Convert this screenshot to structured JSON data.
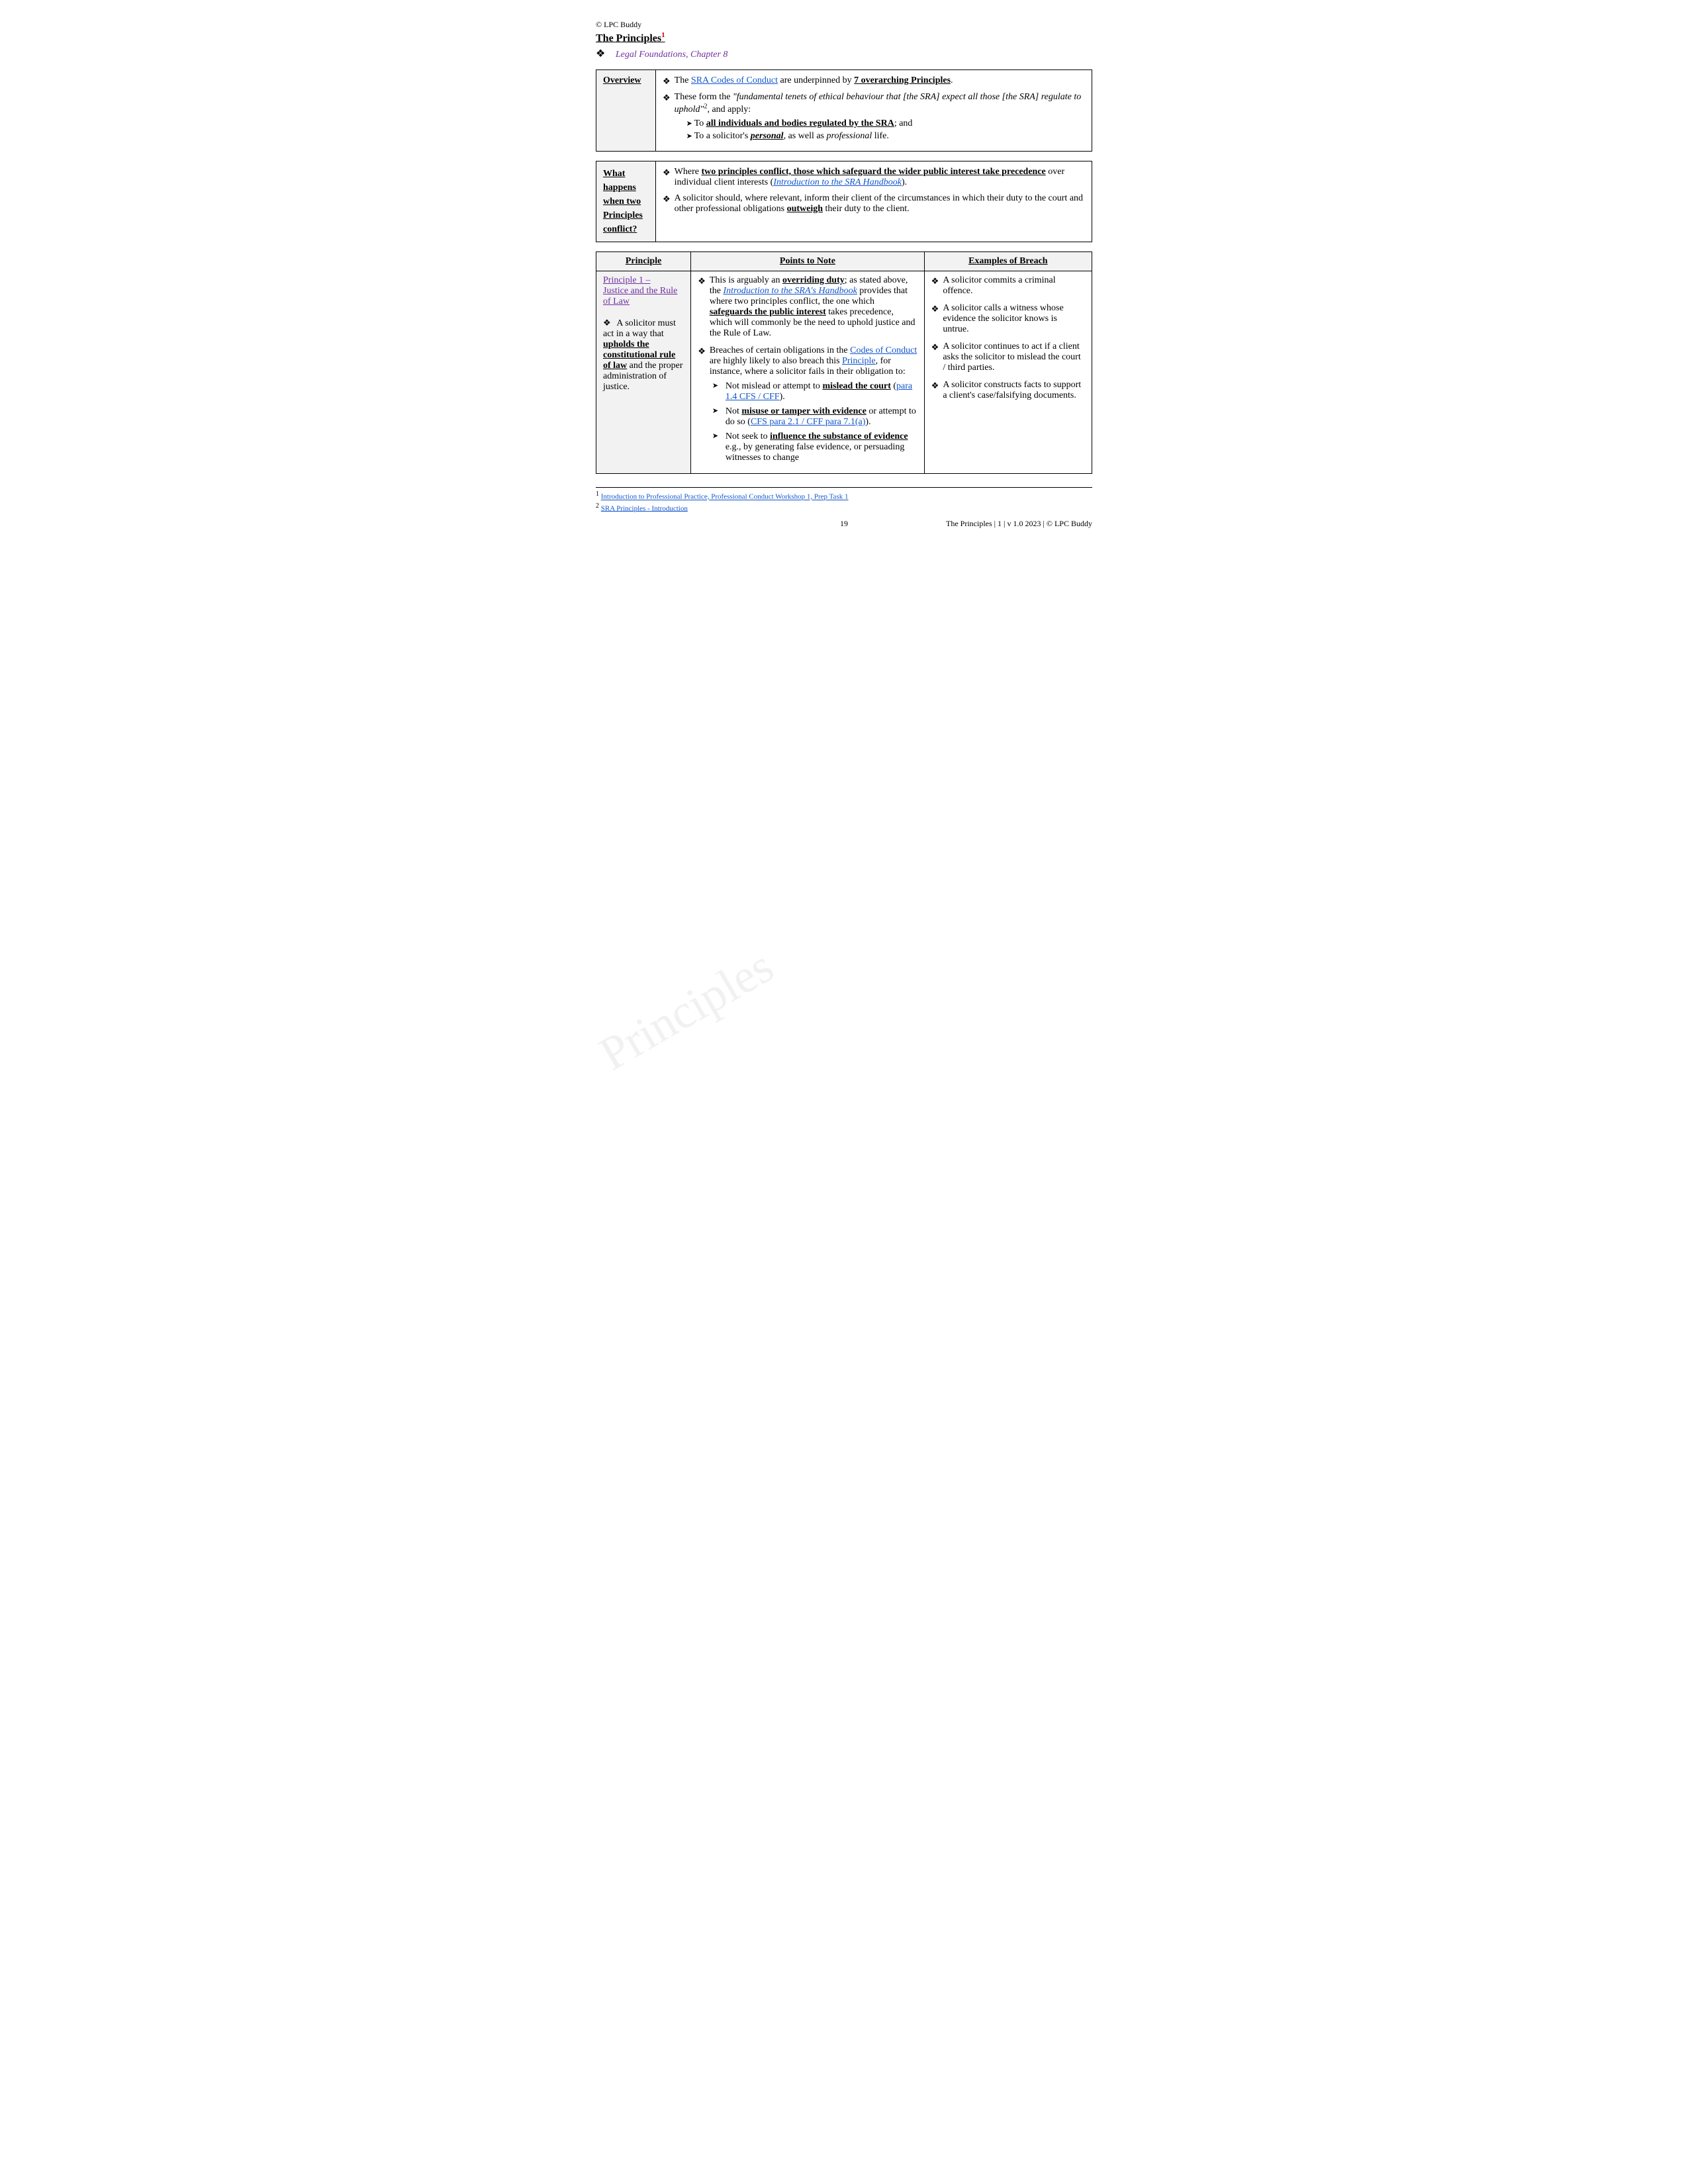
{
  "header": {
    "copyright": "© LPC Buddy",
    "title": "The Principles",
    "title_sup": "1",
    "chapter_link_text": "Legal Foundations, Chapter 8",
    "chapter_link_href": "#"
  },
  "overview": {
    "label": "Overview",
    "bullet1_pre": "The ",
    "bullet1_link": "SRA Codes of Conduct",
    "bullet1_post": " are underpinned by ",
    "bullet1_bold": "7 overarching Principles",
    "bullet1_dot": ".",
    "bullet2_pre": "These form the ",
    "bullet2_quote": "\"fundamental tenets of ethical behaviour that [the SRA] expect all those [the SRA] regulate to uphold\"",
    "bullet2_sup": "2",
    "bullet2_post": ", and apply:",
    "arrow1_bold": "all individuals and bodies regulated by the SRA",
    "arrow1_post": "; and",
    "arrow2_pre": "To a solicitor's ",
    "arrow2_italic_bold": "personal",
    "arrow2_mid": ", as well as ",
    "arrow2_italic": "professional",
    "arrow2_post": " life."
  },
  "what_happens": {
    "label_lines": [
      "What",
      "happens",
      "when two",
      "Principles",
      "conflict?"
    ],
    "bullet1_pre": "Where ",
    "bullet1_bold": "two principles conflict, those which safeguard the wider public interest take precedence",
    "bullet1_post": " over individual client interests (",
    "bullet1_link": "Introduction to the SRA Handbook",
    "bullet1_close": ").",
    "bullet2": "A solicitor should, where relevant, inform their client of the circumstances in which their duty to the court and other professional obligations ",
    "bullet2_bold": "outweigh",
    "bullet2_post": " their duty to the client."
  },
  "principles_table": {
    "headers": [
      "Principle",
      "Points to Note",
      "Examples of Breach"
    ],
    "row1": {
      "principle_link": "Principle 1 –",
      "principle_link2": "Justice and the Rule of Law",
      "principle_body": [
        "A solicitor must act in a way that ",
        "upholds the constitutional rule of law",
        " and the proper administration of justice."
      ],
      "points": [
        {
          "main_pre": "This is arguably an ",
          "main_bold_underline": "overriding duty",
          "main_post": "; as stated above, the ",
          "main_link": "Introduction to the SRA's Handbook",
          "main_link2": " provides that where two principles conflict, the one which ",
          "main_bold2": "safeguards the public interest",
          "main_post2": " takes precedence, which will commonly be the need to uphold justice and the Rule of Law."
        },
        {
          "main": "Breaches of certain obligations in the ",
          "main_link": "Codes of Conduct",
          "main_post": " are highly likely to also breach this ",
          "main_link2": "Principle",
          "main_post2": ", for instance, where a solicitor fails in their obligation to:",
          "arrows": [
            {
              "pre": "Not mislead or attempt to ",
              "bold_underline": "mislead the court",
              "post": " (",
              "link": "para 1.4 CFS / CFF",
              "close": ")."
            },
            {
              "pre": "Not ",
              "bold_underline": "misuse or tamper with evidence",
              "post": " or attempt to do so (",
              "link": "CFS para 2.1 / CFF para 7.1(a)",
              "close": ")."
            },
            {
              "pre": "Not seek to ",
              "bold_underline": "influence the substance of evidence",
              "post": " e.g., by generating false evidence, or persuading witnesses to change"
            }
          ]
        }
      ],
      "examples": [
        "A solicitor commits a criminal offence.",
        "A solicitor calls a witness whose evidence the solicitor knows is untrue.",
        "A solicitor continues to act if a client asks the solicitor to mislead the court / third parties.",
        "A solicitor constructs facts to support a client's case/falsifying documents."
      ]
    }
  },
  "footnotes": [
    {
      "sup": "1",
      "link": "Introduction to Professional Practice, Professional Conduct Workshop 1, Prep Task 1",
      "href": "#"
    },
    {
      "sup": "2",
      "link": "SRA Principles - Introduction",
      "href": "#"
    }
  ],
  "footer": {
    "right": "The Principles | 1 | v 1.0 2023 | © LPC Buddy",
    "page_num": "19"
  }
}
